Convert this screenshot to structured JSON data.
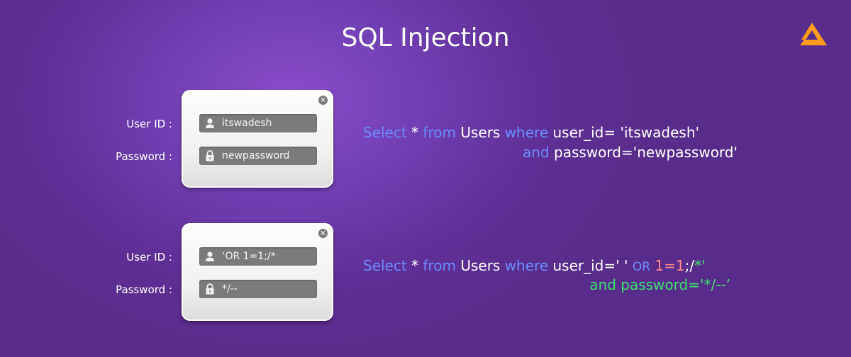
{
  "title": "SQL Injection",
  "logo_icon": "triangle-logo-icon",
  "colors": {
    "keyword": "#6a8cff",
    "injected_number": "#ff8a8a",
    "injected_comment": "#3fe06a",
    "logo": "#ff9a1a"
  },
  "examples": [
    {
      "form": {
        "user_id_label": "User ID :",
        "password_label": "Password :",
        "user_id_value": "itswadesh",
        "password_value": "newpassword",
        "close_icon": "close-icon",
        "user_icon": "user-icon",
        "lock_icon": "lock-icon"
      },
      "query": {
        "line1": {
          "select": "Select",
          "star": " * ",
          "from": "from",
          "users": " Users ",
          "where": "where",
          "rest": " user_id= 'itswadesh'"
        },
        "line2": {
          "and": "and",
          "rest": " password='newpassword'"
        }
      }
    },
    {
      "form": {
        "user_id_label": "User ID :",
        "password_label": "Password :",
        "user_id_value": "‘OR 1=1;/*",
        "password_value": "*/--",
        "close_icon": "close-icon",
        "user_icon": "user-icon",
        "lock_icon": "lock-icon"
      },
      "query": {
        "line1": {
          "select": "Select",
          "star": " * ",
          "from": "from",
          "users": " Users ",
          "where": "where",
          "rest": " user_id=' ' ",
          "or": "OR",
          "space": " ",
          "num": "1=1",
          "semi": ";/",
          "comment": "*'"
        },
        "line2": {
          "text": "and password='*/--’"
        }
      }
    }
  ]
}
